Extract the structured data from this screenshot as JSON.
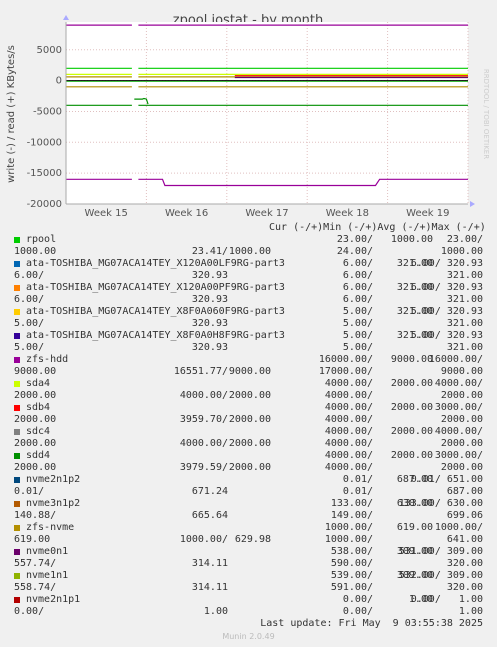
{
  "chart_data": {
    "type": "line",
    "title": "zpool iostat - by month",
    "ylabel": "write (-) / read (+) KBytes/s",
    "watermark": "RRDTOOL / TOBI OETIKER",
    "x_ticks": [
      "Week 15",
      "Week 16",
      "Week 17",
      "Week 18",
      "Week 19"
    ],
    "y_ticks": [
      5000,
      0,
      -5000,
      -10000,
      -15000,
      -20000
    ],
    "y_tick_labels": [
      "5000",
      "0",
      "-5000",
      "-10000",
      "-15000",
      "-20000"
    ],
    "ylim": [
      -20000,
      9500
    ],
    "xlim": [
      0,
      5
    ],
    "grid": true,
    "series_colors": {
      "rpool": "#00cc00",
      "part3_a": "#0066b3",
      "part3_b": "#ff8000",
      "part3_c": "#ffcc00",
      "part3_d": "#330099",
      "zfs-hdd": "#990099",
      "sda4": "#ccff00",
      "sdb4": "#ff0000",
      "sdc4": "#808080",
      "sdd4": "#008f00",
      "nvme2n1p2": "#00487d",
      "nvme3n1p2": "#b35a00",
      "zfs-nvme": "#b38f00",
      "nvme0n1": "#6b006b",
      "nvme1n1": "#8fb300",
      "nvme2n1p1": "#b30000"
    },
    "series": [
      {
        "name": "zfs-hdd",
        "color": "#990099",
        "points": [
          [
            0,
            9000
          ],
          [
            0.82,
            9000
          ],
          [
            0.86,
            null
          ],
          [
            0.9,
            9000
          ],
          [
            5,
            9000
          ]
        ]
      },
      {
        "name": "zfs-hdd",
        "color": "#990099",
        "points": [
          [
            0,
            -16000
          ],
          [
            0.82,
            -16000
          ],
          [
            0.86,
            null
          ],
          [
            0.9,
            -16000
          ],
          [
            1.2,
            -16000
          ],
          [
            1.23,
            -17000
          ],
          [
            3.85,
            -17000
          ],
          [
            3.9,
            -16000
          ],
          [
            5,
            -16000
          ]
        ]
      },
      {
        "name": "rpool",
        "color": "#00cc00",
        "points": [
          [
            0,
            2000
          ],
          [
            0.82,
            2000
          ],
          [
            0.86,
            null
          ],
          [
            0.9,
            2000
          ],
          [
            5,
            2000
          ]
        ]
      },
      {
        "name": "sda4",
        "color": "#ccff00",
        "points": [
          [
            0,
            1000
          ],
          [
            0.82,
            1000
          ],
          [
            0.86,
            null
          ],
          [
            0.9,
            1000
          ],
          [
            5,
            1000
          ]
        ]
      },
      {
        "name": "sdb4",
        "color": "#ff0000",
        "points": [
          [
            2.1,
            800
          ],
          [
            5,
            800
          ]
        ]
      },
      {
        "name": "sdd4",
        "color": "#008f00",
        "points": [
          [
            0,
            -4000
          ],
          [
            0.82,
            -4000
          ],
          [
            0.86,
            null
          ],
          [
            0.9,
            -4000
          ],
          [
            5,
            -4000
          ]
        ]
      },
      {
        "name": "zfs-nvme",
        "color": "#b38f00",
        "points": [
          [
            0,
            600
          ],
          [
            0.82,
            600
          ],
          [
            0.86,
            null
          ],
          [
            0.9,
            600
          ],
          [
            5,
            600
          ]
        ]
      },
      {
        "name": "zfs-nvme",
        "color": "#b38f00",
        "points": [
          [
            0,
            -1000
          ],
          [
            0.82,
            -1000
          ],
          [
            0.86,
            null
          ],
          [
            0.9,
            -1000
          ],
          [
            5,
            -1000
          ]
        ]
      },
      {
        "name": "nvme0n1",
        "color": "#6b006b",
        "points": [
          [
            2.1,
            500
          ],
          [
            5,
            500
          ]
        ]
      },
      {
        "name": "rpool",
        "color": "#00cc00",
        "points": [
          [
            0,
            -100
          ],
          [
            5,
            -100
          ]
        ]
      },
      {
        "name": "sdd4",
        "color": "#008f00",
        "points": [
          [
            0.85,
            -3000
          ],
          [
            0.95,
            -3000
          ],
          [
            0.97,
            -2900
          ],
          [
            1.0,
            -3000
          ],
          [
            1.02,
            -3800
          ]
        ]
      }
    ]
  },
  "legend": {
    "header": "Cur (-/+)Min (-/+)Avg (-/+)Max (-/+)",
    "rows": [
      {
        "name": "rpool",
        "color": "#00cc00",
        "c1": "23.00/",
        "c2": "1000.00",
        "c3": "23.00/",
        "l2a": "1000.00",
        "l2b": "23.41/",
        "l2c": "1000.00",
        "l2d": "24.00/",
        "l2e": "1000.00"
      },
      {
        "name": "ata-TOSHIBA_MG07ACA14TEY_X120A00LF9RG-part3",
        "color": "#0066b3",
        "c1": "6.00/",
        "c2": "321.00",
        "c3": "6.00/ 320.93",
        "l2a": "6.00/",
        "l2b": "320.93",
        "l2c": "",
        "l2d": "6.00/",
        "l2e": "321.00"
      },
      {
        "name": "ata-TOSHIBA_MG07ACA14TEY_X120A00PF9RG-part3",
        "color": "#ff8000",
        "c1": "6.00/",
        "c2": "321.00",
        "c3": "6.00/ 320.93",
        "l2a": "6.00/",
        "l2b": "320.93",
        "l2c": "",
        "l2d": "6.00/",
        "l2e": "321.00"
      },
      {
        "name": "ata-TOSHIBA_MG07ACA14TEY_X8F0A060F9RG-part3",
        "color": "#ffcc00",
        "c1": "5.00/",
        "c2": "321.00",
        "c3": "5.00/ 320.93",
        "l2a": "5.00/",
        "l2b": "320.93",
        "l2c": "",
        "l2d": "5.00/",
        "l2e": "321.00"
      },
      {
        "name": "ata-TOSHIBA_MG07ACA14TEY_X8F0A0H8F9RG-part3",
        "color": "#330099",
        "c1": "5.00/",
        "c2": "321.00",
        "c3": "5.00/ 320.93",
        "l2a": "5.00/",
        "l2b": "320.93",
        "l2c": "",
        "l2d": "5.00/",
        "l2e": "321.00"
      },
      {
        "name": "zfs-hdd",
        "color": "#990099",
        "c1": "16000.00/",
        "c2": "9000.00",
        "c3": "16000.00/",
        "l2a": "9000.00",
        "l2b": "16551.77/",
        "l2c": "9000.00",
        "l2d": "17000.00/",
        "l2e": "9000.00"
      },
      {
        "name": "sda4",
        "color": "#ccff00",
        "c1": "4000.00/",
        "c2": "2000.00",
        "c3": "4000.00/",
        "l2a": "2000.00",
        "l2b": "4000.00/",
        "l2c": "2000.00",
        "l2d": "4000.00/",
        "l2e": "2000.00"
      },
      {
        "name": "sdb4",
        "color": "#ff0000",
        "c1": "4000.00/",
        "c2": "2000.00",
        "c3": "3000.00/",
        "l2a": "2000.00",
        "l2b": "3959.70/",
        "l2c": "2000.00",
        "l2d": "4000.00/",
        "l2e": "2000.00"
      },
      {
        "name": "sdc4",
        "color": "#808080",
        "c1": "4000.00/",
        "c2": "2000.00",
        "c3": "4000.00/",
        "l2a": "2000.00",
        "l2b": "4000.00/",
        "l2c": "2000.00",
        "l2d": "4000.00/",
        "l2e": "2000.00"
      },
      {
        "name": "sdd4",
        "color": "#008f00",
        "c1": "4000.00/",
        "c2": "2000.00",
        "c3": "3000.00/",
        "l2a": "2000.00",
        "l2b": "3979.59/",
        "l2c": "2000.00",
        "l2d": "4000.00/",
        "l2e": "2000.00"
      },
      {
        "name": "nvme2n1p2",
        "color": "#00487d",
        "c1": "0.01/",
        "c2": "687.00",
        "c3": "0.01/ 651.00",
        "l2a": "0.01/",
        "l2b": "671.24",
        "l2c": "",
        "l2d": "0.01/",
        "l2e": "687.00"
      },
      {
        "name": "nvme3n1p2",
        "color": "#b35a00",
        "c1": "133.00/",
        "c2": "630.00",
        "c3": "133.00/ 630.00",
        "l2a": "140.88/",
        "l2b": "665.64",
        "l2c": "",
        "l2d": "149.00/",
        "l2e": "699.06"
      },
      {
        "name": "zfs-nvme",
        "color": "#b38f00",
        "c1": "1000.00/",
        "c2": "619.00",
        "c3": "1000.00/",
        "l2a": "619.00",
        "l2b": "1000.00/",
        "l2c": "629.98",
        "l2d": "1000.00/",
        "l2e": "641.00"
      },
      {
        "name": "nvme0n1",
        "color": "#6b006b",
        "c1": "538.00/",
        "c2": "309.00",
        "c3": "531.00/ 309.00",
        "l2a": "557.74/",
        "l2b": "314.11",
        "l2c": "",
        "l2d": "590.00/",
        "l2e": "320.00"
      },
      {
        "name": "nvme1n1",
        "color": "#8fb300",
        "c1": "539.00/",
        "c2": "309.00",
        "c3": "532.00/ 309.00",
        "l2a": "558.74/",
        "l2b": "314.11",
        "l2c": "",
        "l2d": "591.00/",
        "l2e": "320.00"
      },
      {
        "name": "nvme2n1p1",
        "color": "#b30000",
        "c1": "0.00/",
        "c2": "1.00",
        "c3": "0.00/   1.00",
        "l2a": "0.00/",
        "l2b": "1.00",
        "l2c": "",
        "l2d": "0.00/",
        "l2e": "1.00"
      }
    ],
    "last_update": "Last update: Fri May  9 03:55:38 2025",
    "munin_version": "Munin 2.0.49"
  }
}
